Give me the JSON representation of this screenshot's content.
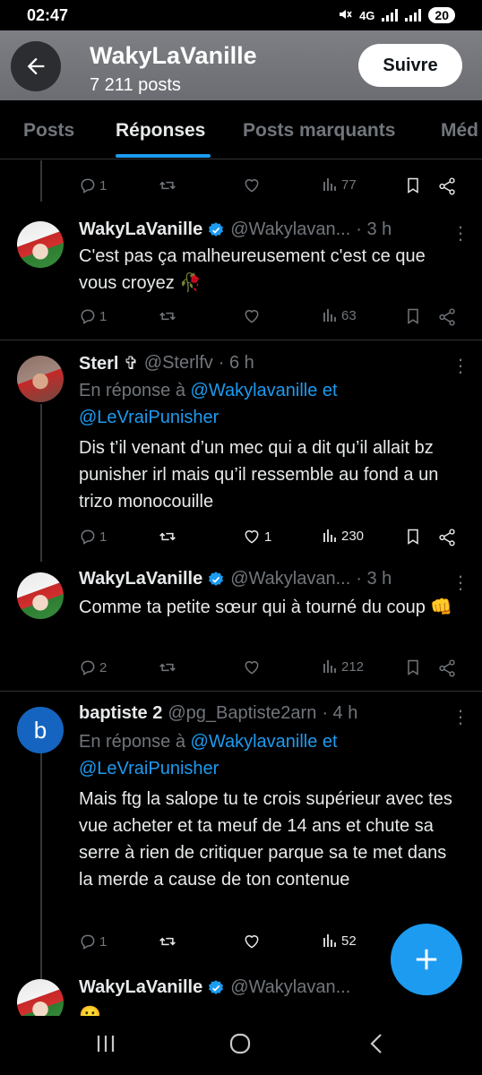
{
  "status_bar": {
    "time": "02:47",
    "network": "4G",
    "battery": "20"
  },
  "header": {
    "title": "WakyLaVanille",
    "posts_count": "7 211 posts",
    "follow_label": "Suivre"
  },
  "tabs": [
    {
      "label": "Posts"
    },
    {
      "label": "Réponses"
    },
    {
      "label": "Posts marquants"
    },
    {
      "label": "Méd"
    }
  ],
  "top_actions": {
    "replies": "1",
    "views": "77"
  },
  "tweets": [
    {
      "name": "WakyLaVanille",
      "verified": true,
      "handle": "@Wakylavan...",
      "time": "· 3 h",
      "text": "C'est pas ça malheureusement c'est ce que vous croyez 🥀",
      "replies": "1",
      "retweets": "",
      "likes": "",
      "views": "63"
    },
    {
      "name": "Sterl ✞",
      "verified": false,
      "handle": "@Sterlfv",
      "time": "· 6 h",
      "reply_prefix": "En réponse à",
      "reply_to": "@Wakylavanille et @LeVraiPunisher",
      "text": "Dis t’il venant d’un mec qui a dit qu’il allait bz punisher irl mais qu’il ressemble au fond a un trizo monocouille",
      "replies": "1",
      "retweets": "",
      "likes": "1",
      "views": "230"
    },
    {
      "name": "WakyLaVanille",
      "verified": true,
      "handle": "@Wakylavan...",
      "time": "· 3 h",
      "text": "Comme ta petite sœur qui à tourné du coup 👊",
      "replies": "2",
      "retweets": "",
      "likes": "",
      "views": "212"
    },
    {
      "name": "baptiste 2",
      "verified": false,
      "handle": "@pg_Baptiste2arn",
      "time": "· 4 h",
      "avatar_letter": "b",
      "reply_prefix": "En réponse à",
      "reply_to": "@Wakylavanille et @LeVraiPunisher",
      "text": "Mais ftg  la salope tu te crois supérieur avec tes vue acheter et ta meuf de 14 ans et chute sa serre à rien de critiquer parque sa te met dans la merde a cause de ton contenue",
      "replies": "1",
      "retweets": "",
      "likes": "",
      "views": "52"
    },
    {
      "name": "WakyLaVanille",
      "verified": true,
      "handle": "@Wakylavan...",
      "time": "",
      "text": "😬"
    }
  ],
  "colors": {
    "accent": "#1d9bf0",
    "background": "#000000",
    "muted": "#71767b",
    "header_bg": "#75777c"
  },
  "icons": [
    "back-arrow-icon",
    "verified-badge-icon",
    "reply-icon",
    "retweet-icon",
    "like-icon",
    "views-icon",
    "bookmark-icon",
    "share-icon",
    "more-icon",
    "compose-plus-icon",
    "recent-apps-icon",
    "home-icon",
    "back-nav-icon"
  ]
}
